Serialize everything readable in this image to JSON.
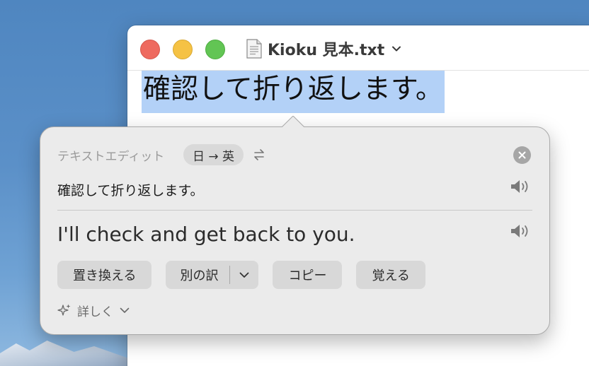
{
  "window": {
    "title": "Kioku 見本.txt"
  },
  "document": {
    "selected_text": "確認して折り返します。"
  },
  "popover": {
    "source_app": "テキストエディット",
    "language_pair": "日 → 英",
    "source_text": "確認して折り返します。",
    "translated_text": "I'll check and get back to you.",
    "buttons": {
      "replace": "置き換える",
      "alternative": "別の訳",
      "copy": "コピー",
      "remember": "覚える"
    },
    "more_label": "詳しく"
  },
  "colors": {
    "selection": "#b3d1f7",
    "close_traffic": "#ee6a5f",
    "minimize_traffic": "#f5c244",
    "maximize_traffic": "#62c554"
  }
}
